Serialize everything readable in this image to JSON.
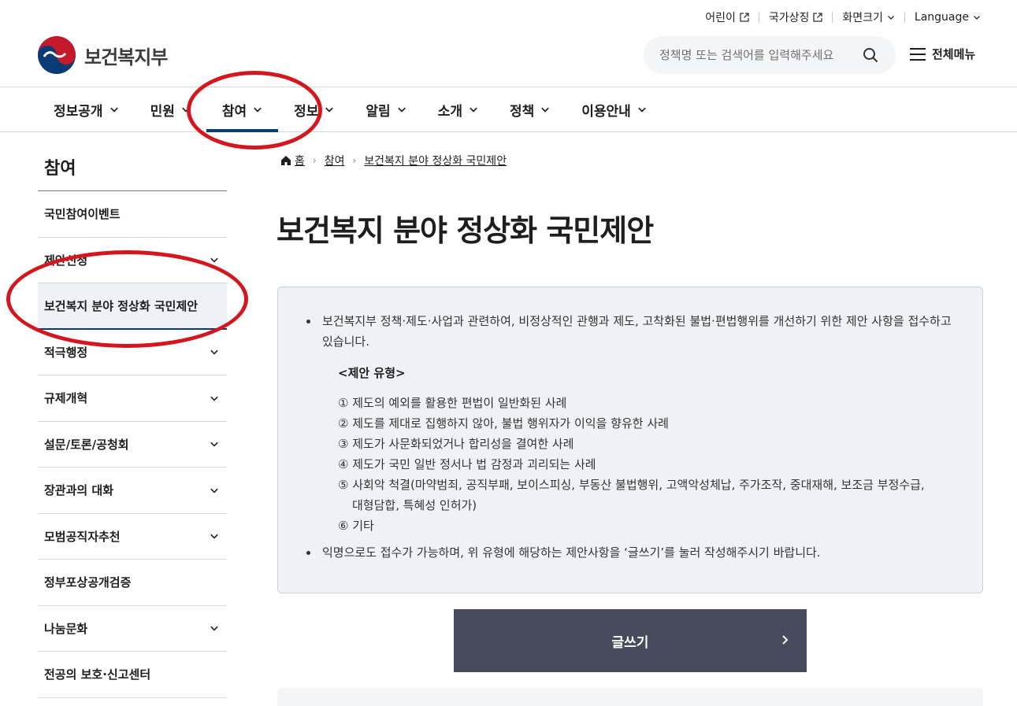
{
  "utility": {
    "items": [
      {
        "label": "어린이",
        "icon": "external-link-icon"
      },
      {
        "label": "국가상징",
        "icon": "external-link-icon"
      },
      {
        "label": "화면크기",
        "icon": "chevron-down-icon"
      },
      {
        "label": "Language",
        "icon": "chevron-down-icon"
      }
    ]
  },
  "header": {
    "logo_text": "보건복지부",
    "search_placeholder": "정책명 또는 검색어를 입력해주세요",
    "all_menu_label": "전체메뉴"
  },
  "gnb": {
    "items": [
      {
        "label": "정보공개"
      },
      {
        "label": "민원"
      },
      {
        "label": "참여",
        "active": true
      },
      {
        "label": "정보"
      },
      {
        "label": "알림"
      },
      {
        "label": "소개"
      },
      {
        "label": "정책"
      },
      {
        "label": "이용안내"
      }
    ]
  },
  "lnb": {
    "title": "참여",
    "items": [
      {
        "label": "국민참여이벤트",
        "has_chevron": false
      },
      {
        "label": "제안신청",
        "has_chevron": true
      },
      {
        "label": "보건복지 분야 정상화 국민제안",
        "has_chevron": false,
        "active": true
      },
      {
        "label": "적극행정",
        "has_chevron": true
      },
      {
        "label": "규제개혁",
        "has_chevron": true
      },
      {
        "label": "설문/토론/공청회",
        "has_chevron": true
      },
      {
        "label": "장관과의 대화",
        "has_chevron": true
      },
      {
        "label": "모범공직자추천",
        "has_chevron": true
      },
      {
        "label": "정부포상공개검증",
        "has_chevron": false
      },
      {
        "label": "나눔문화",
        "has_chevron": true
      },
      {
        "label": "전공의 보호·신고센터",
        "has_chevron": false
      }
    ]
  },
  "breadcrumb": {
    "home": "홈",
    "level1": "참여",
    "level2": "보건복지 분야 정상화 국민제안"
  },
  "page_title": "보건복지 분야 정상화 국민제안",
  "info": {
    "intro": "보건복지부 정책·제도·사업과 관련하여, 비정상적인 관행과 제도, 고착화된 불법·편법행위를 개선하기 위한 제안 사항을 접수하고 있습니다.",
    "types_heading": "<제안 유형>",
    "types": [
      "① 제도의 예외를 활용한 편법이 일반화된 사례",
      "② 제도를 제대로 집행하지 않아, 불법 행위자가 이익을 향유한 사례",
      "③ 제도가 사문화되었거나 합리성을 결여한 사례",
      "④ 제도가 국민 일반 정서나 법 감정과 괴리되는 사례",
      "⑤ 사회악 척결(마약범죄, 공직부패, 보이스피싱, 부동산 불법행위, 고액악성체납, 주가조작, 중대재해, 보조금 부정수급,",
      "⑥ 기타"
    ],
    "type5_cont": "대형담합, 특혜성 인허가)",
    "note": "익명으로도 접수가 가능하며, 위 유형에 해당하는 제안사항을 ‘글쓰기’를 눌러 작성해주시기 바랍니다."
  },
  "write_button": "글쓰기",
  "colors": {
    "primary": "#0b3b75",
    "button_bg": "#474b5b",
    "info_bg": "#eef1f6",
    "annotation": "#d4161f"
  }
}
